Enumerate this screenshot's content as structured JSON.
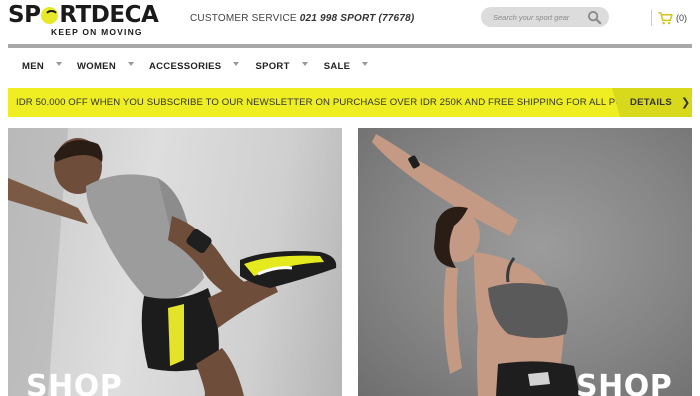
{
  "header": {
    "logo_text_before": "SP",
    "logo_text_after": "RTDECA",
    "logo_tagline": "KEEP ON MOVING",
    "customer_service_label": "CUSTOMER SERVICE",
    "customer_service_phone": "021 998 SPORT (77678)",
    "search_placeholder": "Search your sport gear",
    "cart_count": "(0)"
  },
  "nav": {
    "items": [
      {
        "label": "MEN"
      },
      {
        "label": "WOMEN"
      },
      {
        "label": "ACCESSORIES"
      },
      {
        "label": "SPORT"
      },
      {
        "label": "SALE"
      }
    ]
  },
  "promo": {
    "text": "IDR 50.000 OFF WHEN YOU SUBSCRIBE TO OUR NEWSLETTER ON PURCHASE OVER IDR 250K AND FREE SHIPPING FOR ALL PURCHASE",
    "details_label": "DETAILS"
  },
  "tiles": [
    {
      "label": "SHOP"
    },
    {
      "label": "SHOP"
    }
  ],
  "colors": {
    "accent_yellow": "#eeee22",
    "accent_yellow_dark": "#d8d81c",
    "text_dark": "#222222"
  }
}
